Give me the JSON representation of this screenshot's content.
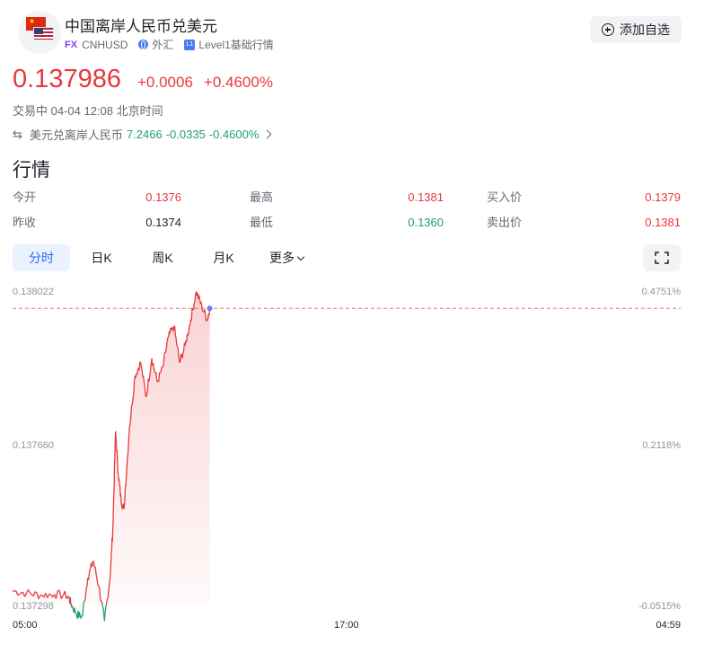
{
  "header": {
    "title": "中国离岸人民币兑美元",
    "fx_badge": "FX",
    "symbol": "CNHUSD",
    "market": "外汇",
    "level_badge": "L1",
    "level_label": "Level1基础行情",
    "add_watchlist": "添加自选"
  },
  "quote": {
    "price": "0.137986",
    "change": "+0.0006",
    "change_pct": "+0.4600%",
    "status": "交易中 04-04 12:08 北京时间"
  },
  "related": {
    "name": "美元兑离岸人民币",
    "price": "7.2466",
    "change": "-0.0335",
    "change_pct": "-0.4600%"
  },
  "section_title": "行情",
  "stats": {
    "open_label": "今开",
    "open": "0.1376",
    "high_label": "最高",
    "high": "0.1381",
    "bid_label": "买入价",
    "bid": "0.1379",
    "prev_close_label": "昨收",
    "prev_close": "0.1374",
    "low_label": "最低",
    "low": "0.1360",
    "ask_label": "卖出价",
    "ask": "0.1381"
  },
  "tabs": [
    "分时",
    "日K",
    "周K",
    "月K",
    "更多"
  ],
  "active_tab": "分时",
  "colors": {
    "up": "#e8383d",
    "down": "#1fa06c",
    "accent": "#2b6cf5"
  },
  "chart_data": {
    "type": "line",
    "y_tick_labels": [
      "0.138022",
      "0.137660",
      "0.137298"
    ],
    "pct_tick_labels": [
      "0.4751%",
      "0.2118%",
      "-0.0515%"
    ],
    "x_tick_labels": [
      "05:00",
      "17:00",
      "04:59"
    ],
    "ylim": [
      0.137298,
      0.138022
    ],
    "reference_price": 0.137986,
    "x_hours_since_start": [
      0,
      0.5,
      1.0,
      1.5,
      2.0,
      2.1,
      2.3,
      2.5,
      2.7,
      2.9,
      3.1,
      3.3,
      3.5,
      3.6,
      3.7,
      3.8,
      3.9,
      4.0,
      4.2,
      4.4,
      4.6,
      4.8,
      5.0,
      5.2,
      5.4,
      5.6,
      5.8,
      6.0,
      6.2,
      6.4,
      6.6,
      6.8,
      7.0,
      7.08
    ],
    "values": [
      0.13733,
      0.137325,
      0.13732,
      0.137322,
      0.137318,
      0.1373,
      0.137275,
      0.13727,
      0.13736,
      0.1374,
      0.13734,
      0.13726,
      0.13736,
      0.13747,
      0.1377,
      0.1376,
      0.13754,
      0.13752,
      0.13771,
      0.13783,
      0.13786,
      0.13778,
      0.13787,
      0.137815,
      0.13785,
      0.13792,
      0.137945,
      0.13786,
      0.1379,
      0.13796,
      0.138025,
      0.13799,
      0.13796,
      0.137986
    ]
  }
}
